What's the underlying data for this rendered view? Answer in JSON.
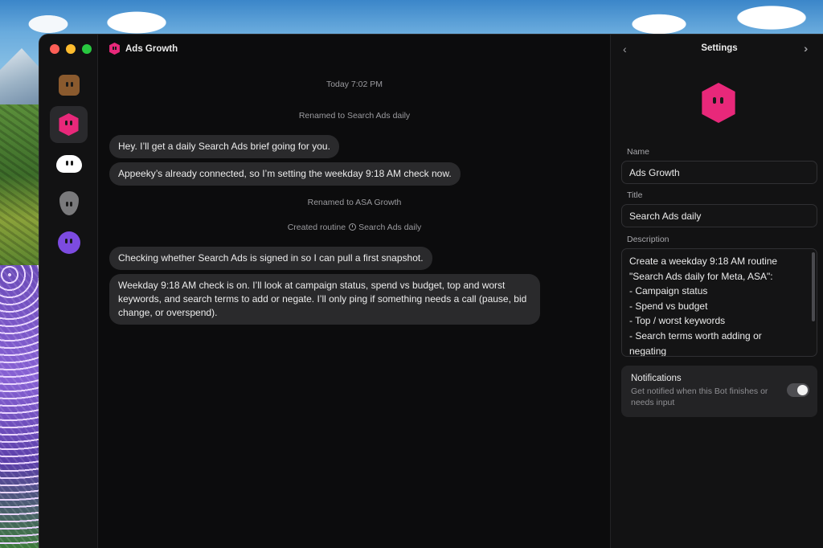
{
  "window": {
    "title": "Ads Growth"
  },
  "rail": {
    "bots": [
      {
        "icon": "brown-square-bot-icon",
        "color": "#8a5a2e"
      },
      {
        "icon": "pink-hexagon-bot-icon",
        "color": "#e8287a",
        "active": true
      },
      {
        "icon": "white-cloud-bot-icon",
        "color": "#ffffff"
      },
      {
        "icon": "gray-drop-bot-icon",
        "color": "#7a7a7c"
      },
      {
        "icon": "purple-circle-bot-icon",
        "color": "#7c4be0"
      }
    ]
  },
  "chat": {
    "timestamp": "Today 7:02 PM",
    "events": {
      "renamed_1": "Renamed to Search Ads daily",
      "renamed_2": "Renamed to ASA Growth",
      "created_prefix": "Created routine",
      "created_name": "Search Ads daily"
    },
    "messages": [
      "Hey. I’ll get a daily Search Ads brief going for you.",
      "Appeeky’s already connected, so I’m setting the weekday 9:18 AM check now.",
      "Checking whether Search Ads is signed in so I can pull a first snapshot.",
      "Weekday 9:18 AM check is on. I’ll look at campaign status, spend vs budget, top and worst keywords, and search terms to add or negate. I’ll only ping if something needs a call (pause, bid change, or overspend)."
    ]
  },
  "settings": {
    "title": "Settings",
    "name_label": "Name",
    "name_value": "Ads Growth",
    "title_label": "Title",
    "title_value": "Search Ads daily",
    "description_label": "Description",
    "description_lines": [
      "Create a weekday 9:18 AM routine",
      "\"Search Ads daily for Meta, ASA\":",
      "- Campaign status",
      "- Spend vs budget",
      "- Top / worst keywords",
      "- Search terms worth adding or",
      "negating"
    ],
    "notifications": {
      "title": "Notifications",
      "subtitle": "Get notified when this Bot finishes or needs input",
      "enabled": true
    }
  },
  "colors": {
    "accent_pink": "#e8287a",
    "bubble": "#2a2a2c",
    "background": "#0c0c0d"
  }
}
